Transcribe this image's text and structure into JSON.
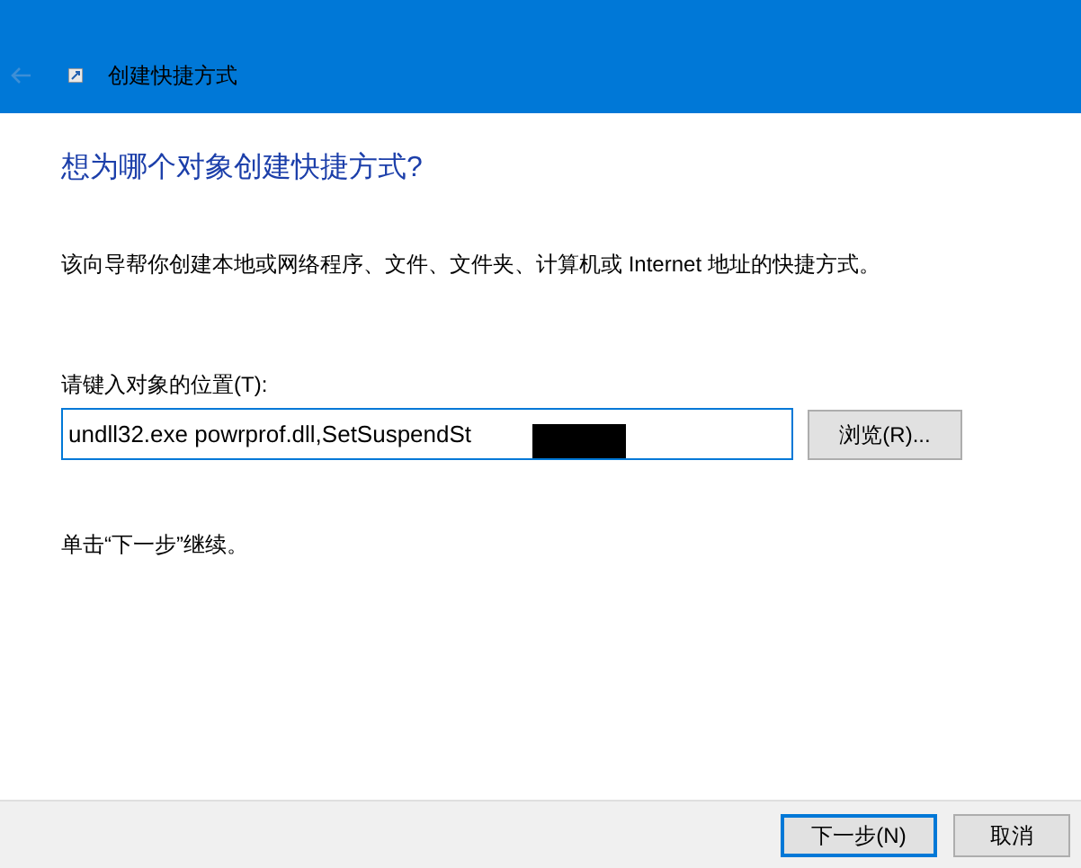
{
  "window": {
    "title": "创建快捷方式"
  },
  "heading": "想为哪个对象创建快捷方式?",
  "description": "该向导帮你创建本地或网络程序、文件、文件夹、计算机或 Internet 地址的快捷方式。",
  "location": {
    "label": "请键入对象的位置(T):",
    "value": "undll32.exe powrprof.dll,SetSuspendSt",
    "redacted": true,
    "browse_button": "浏览(R)..."
  },
  "hint": "单击“下一步”继续。",
  "buttons": [
    {
      "label": "下一步(N)",
      "default": true
    },
    {
      "label": "取消",
      "default": false
    }
  ]
}
